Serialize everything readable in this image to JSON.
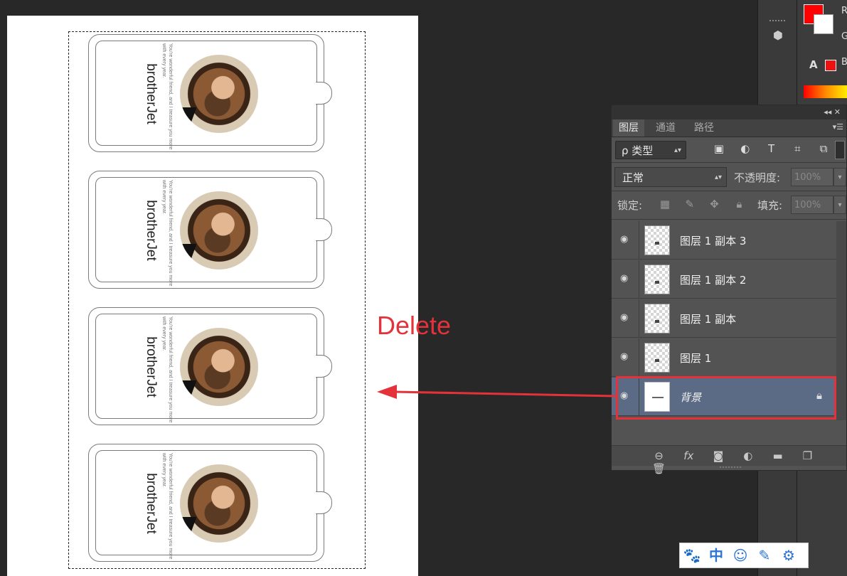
{
  "document": {
    "tags": [
      {
        "brand": "brotherJet",
        "blurb": "You're wonderful friend, and I treasure you more with every year."
      },
      {
        "brand": "brotherJet",
        "blurb": "You're wonderful friend, and I treasure you more with every year."
      },
      {
        "brand": "brotherJet",
        "blurb": "You're wonderful friend, and I treasure you more with every year."
      },
      {
        "brand": "brotherJet",
        "blurb": "You're wonderful friend, and I treasure you more with every year."
      }
    ]
  },
  "annotation": {
    "label": "Delete",
    "color": "#e3323a"
  },
  "side": {
    "r": "R",
    "g": "G",
    "b": "B",
    "alert": "A"
  },
  "layers_panel": {
    "collapse": "◂◂  ✕",
    "tabs": [
      "图层",
      "通道",
      "路径"
    ],
    "filter_kind": "ρ 类型",
    "blend_mode": "正常",
    "opacity_label": "不透明度:",
    "opacity_value": "100%",
    "lock_label": "锁定:",
    "fill_label": "填充:",
    "fill_value": "100%",
    "layers": [
      {
        "name": "图层 1 副本 3"
      },
      {
        "name": "图层 1 副本 2"
      },
      {
        "name": "图层 1 副本"
      },
      {
        "name": "图层 1"
      },
      {
        "name": "背景",
        "selected": true,
        "locked": true
      }
    ]
  },
  "ime": {
    "items": [
      "🐾",
      "中",
      "☺",
      "✎",
      "⚙"
    ]
  }
}
